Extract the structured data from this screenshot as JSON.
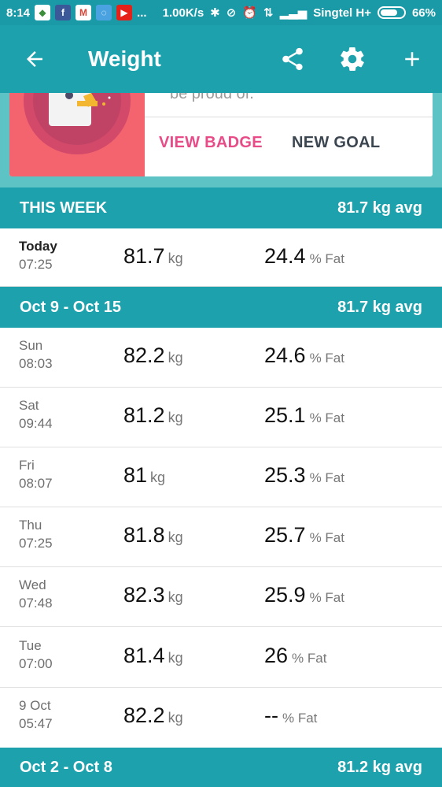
{
  "status_bar": {
    "time": "8:14",
    "more": "...",
    "speed": "1.00K/s",
    "carrier": "Singtel H+",
    "battery": "66%",
    "battery_level": 0.66
  },
  "app_bar": {
    "title": "Weight"
  },
  "badge_card": {
    "text": "be proud of.",
    "view_badge": "VIEW BADGE",
    "new_goal": "NEW GOAL"
  },
  "this_week": {
    "label": "THIS WEEK",
    "avg": "81.7 kg avg",
    "rows": [
      {
        "day": "Today",
        "time": "07:25",
        "weight": "81.7",
        "weight_unit": "kg",
        "fat": "24.4",
        "fat_unit": "% Fat"
      }
    ]
  },
  "week_oct9": {
    "label": "Oct 9 - Oct 15",
    "avg": "81.7 kg avg",
    "rows": [
      {
        "day": "Sun",
        "time": "08:03",
        "weight": "82.2",
        "weight_unit": "kg",
        "fat": "24.6",
        "fat_unit": "% Fat"
      },
      {
        "day": "Sat",
        "time": "09:44",
        "weight": "81.2",
        "weight_unit": "kg",
        "fat": "25.1",
        "fat_unit": "% Fat"
      },
      {
        "day": "Fri",
        "time": "08:07",
        "weight": "81",
        "weight_unit": "kg",
        "fat": "25.3",
        "fat_unit": "% Fat"
      },
      {
        "day": "Thu",
        "time": "07:25",
        "weight": "81.8",
        "weight_unit": "kg",
        "fat": "25.7",
        "fat_unit": "% Fat"
      },
      {
        "day": "Wed",
        "time": "07:48",
        "weight": "82.3",
        "weight_unit": "kg",
        "fat": "25.9",
        "fat_unit": "% Fat"
      },
      {
        "day": "Tue",
        "time": "07:00",
        "weight": "81.4",
        "weight_unit": "kg",
        "fat": "26",
        "fat_unit": "% Fat"
      },
      {
        "day": "9 Oct",
        "time": "05:47",
        "weight": "82.2",
        "weight_unit": "kg",
        "fat": "--",
        "fat_unit": "% Fat"
      }
    ]
  },
  "week_oct2": {
    "label": "Oct 2 - Oct 8",
    "avg": "81.2 kg avg"
  },
  "colors": {
    "primary": "#1da2ad",
    "accent_pink": "#e84c88",
    "badge_bg": "#f4646f"
  },
  "icons": [
    "back-arrow-icon",
    "share-icon",
    "settings-gear-icon",
    "add-plus-icon",
    "bluetooth-icon",
    "alarm-icon",
    "signal-icon",
    "battery-icon"
  ]
}
